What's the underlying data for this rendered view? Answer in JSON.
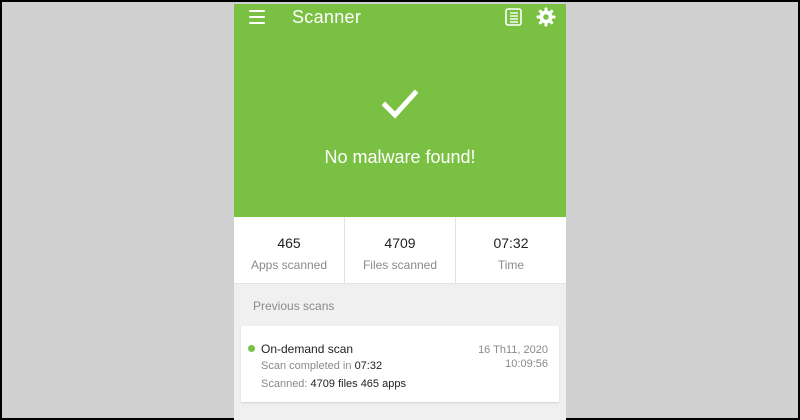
{
  "appbar": {
    "title": "Scanner"
  },
  "hero": {
    "status": "No malware found!",
    "color": "#7ac143"
  },
  "stats": [
    {
      "value": "465",
      "label": "Apps scanned"
    },
    {
      "value": "4709",
      "label": "Files scanned"
    },
    {
      "value": "07:32",
      "label": "Time"
    }
  ],
  "previous_scans": {
    "title": "Previous scans",
    "items": [
      {
        "type": "On-demand scan",
        "completed_prefix": "Scan completed in",
        "completed_time": "07:32",
        "scanned_prefix": "Scanned:",
        "scanned_summary": "4709 files 465 apps",
        "date": "16 Th11, 2020",
        "time": "10:09:56"
      }
    ]
  },
  "icons": {
    "menu": "menu-icon",
    "report": "report-icon",
    "settings": "gear-icon",
    "check": "check-icon"
  }
}
